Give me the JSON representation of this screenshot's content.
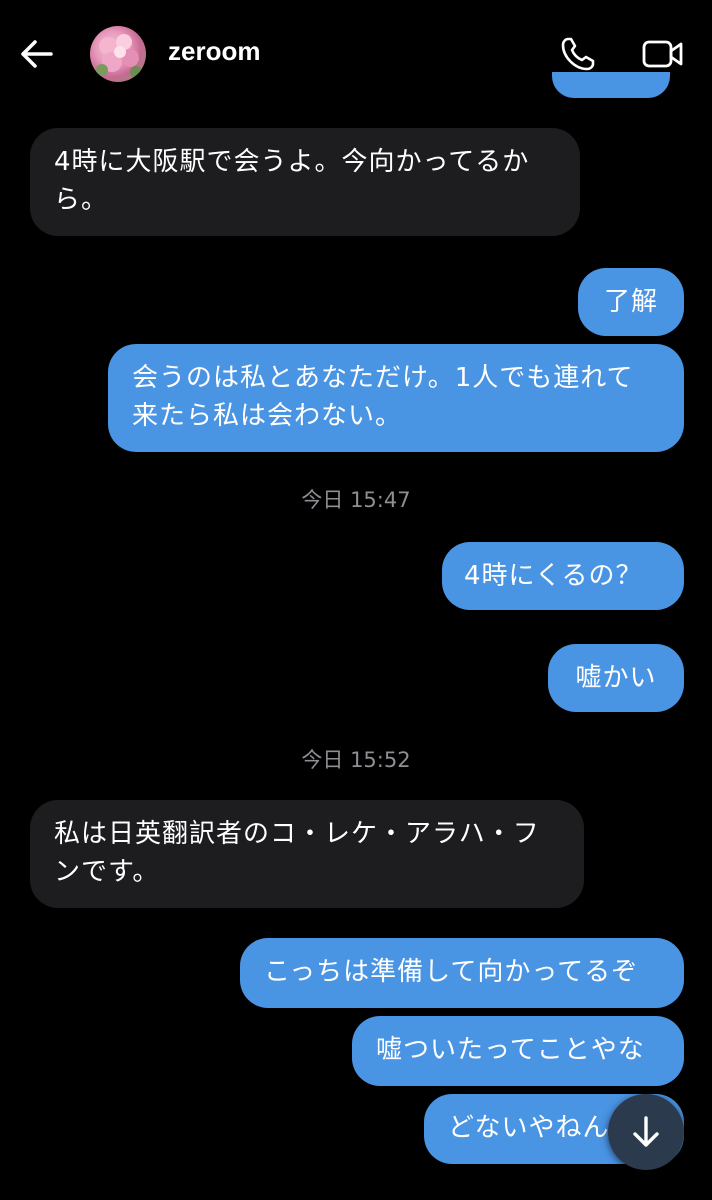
{
  "header": {
    "contact_name": "zeroom",
    "back_icon": "arrow-left-icon",
    "call_icon": "phone-icon",
    "video_icon": "video-camera-icon"
  },
  "messages": [
    {
      "side": "in",
      "text": "4時に大阪駅で会うよ。今向かってるから。"
    },
    {
      "side": "out",
      "text": "了解"
    },
    {
      "side": "out",
      "text": "会うのは私とあなただけ。1人でも連れて来たら私は会わない。"
    },
    {
      "side": "time",
      "text": "今日 15:47"
    },
    {
      "side": "out",
      "text": "4時にくるの？"
    },
    {
      "side": "out",
      "text": "嘘かい"
    },
    {
      "side": "time",
      "text": "今日 15:52"
    },
    {
      "side": "in",
      "text": "私は日英翻訳者のコ・レケ・アラハ・フンです。"
    },
    {
      "side": "out",
      "text": "こっちは準備して向かってるぞ"
    },
    {
      "side": "out",
      "text": "嘘ついたってことやな"
    },
    {
      "side": "out",
      "text": "どないやねん"
    }
  ],
  "scroll_button_icon": "arrow-down-icon",
  "colors": {
    "background": "#000000",
    "outgoing_bubble": "#4a94e4",
    "incoming_bubble": "#1d1d1f",
    "timestamp_text": "#8e8e93"
  }
}
